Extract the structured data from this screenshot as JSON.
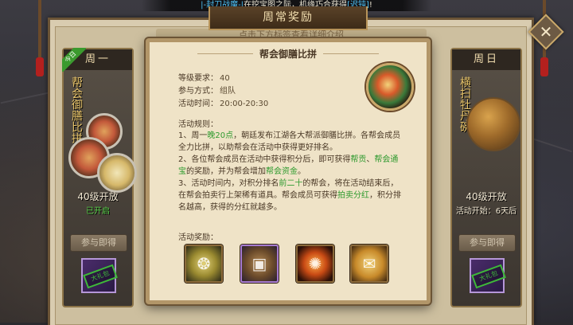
{
  "ticker": {
    "prefix": "|-封刀战魔-|",
    "middle": "在挖宝图之际，机缘巧合获得",
    "item": "[迟钝]",
    "suffix": "!"
  },
  "window": {
    "title": "周常奖励",
    "hint": "点击下方标签查看详细介绍"
  },
  "days": {
    "left": {
      "day": "周一",
      "badge": "今日",
      "name": "帮会御膳比拼",
      "level": "40级开放",
      "status": "已开启",
      "join_label": "参与即得",
      "reward_stamp": "大礼包"
    },
    "right": {
      "day": "周日",
      "name": "横扫牡丹碗",
      "level": "40级开放",
      "status": "活动开始：6天后",
      "join_label": "参与即得",
      "reward_stamp": "大礼包"
    }
  },
  "popup": {
    "title": "帮会御膳比拼",
    "level_label": "等级要求：",
    "level_value": "40",
    "mode_label": "参与方式：",
    "mode_value": "组队",
    "time_label": "活动时间：",
    "time_value": "20:00-20:30",
    "rules_title": "活动规则：",
    "rules": {
      "r1a": "1、周一",
      "r1b": "晚20点",
      "r1c": "，朝廷发布江湖各大帮派御膳比拼。各帮会成员全力比拼，以助帮会在活动中获得更好排名。",
      "r2a": "2、各位帮会成员在活动中获得积分后，即可获得",
      "r2b": "帮贡",
      "r2c": "、",
      "r2d": "帮会通宝",
      "r2e": "的奖励，并为帮会增加",
      "r2f": "帮会资金",
      "r2g": "。",
      "r3a": "3、活动时间内，对积分排名",
      "r3b": "前二十",
      "r3c": "的帮会，将在活动结束后，在帮会拍卖行上架稀有道具。帮会成员可获得",
      "r3d": "拍卖分红",
      "r3e": "，积分排名越高，获得的分红就越多。"
    },
    "rewards_title": "活动奖励：",
    "reward_icons": [
      "jade-token-icon",
      "treasure-chest-icon",
      "flame-orb-icon",
      "scroll-icon"
    ]
  },
  "colors": {
    "highlight_green": "#2e9a2e",
    "panel_bg": "#efe3c7",
    "frame": "#b29669",
    "title_text": "#4a3826"
  }
}
